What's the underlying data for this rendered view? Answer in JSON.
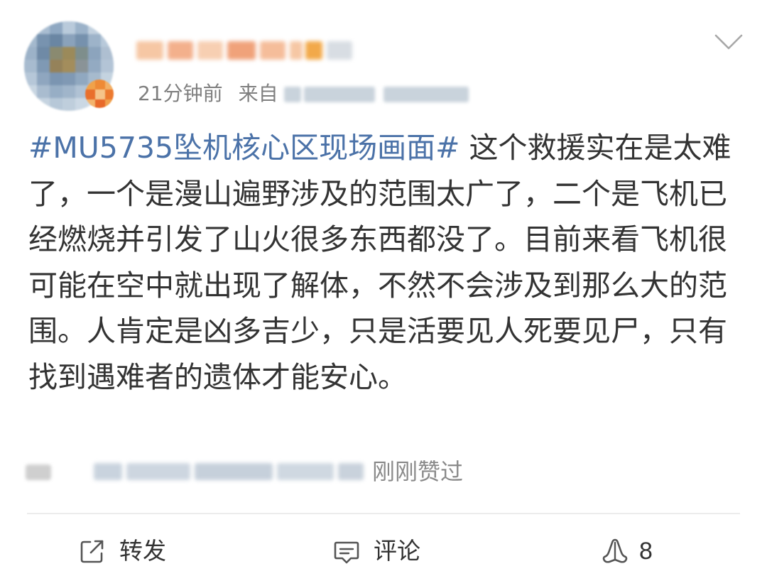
{
  "post": {
    "meta": {
      "time": "21分钟前",
      "from_prefix": "来自"
    },
    "content": {
      "hashtag": "#MU5735坠机核心区现场画面#",
      "text": " 这个救援实在是太难了，一个是漫山遍野涉及的范围太广了，二个是飞机已经燃烧并引发了山火很多东西都没了。目前来看飞机很可能在空中就出现了解体，不然不会涉及到那么大的范围。人肯定是凶多吉少，只是活要见人死要见尸，只有找到遇难者的遗体才能安心。"
    },
    "liked": {
      "suffix": "刚刚赞过"
    },
    "actions": {
      "forward": {
        "label": "转发",
        "icon": "share-out-icon"
      },
      "comment": {
        "label": "评论",
        "icon": "comment-bubble-icon"
      },
      "like": {
        "count": "8",
        "icon": "thumbs-up-icon"
      }
    },
    "menu": {
      "icon": "chevron-down-icon"
    }
  },
  "colors": {
    "hashtag": "#4b72a8",
    "body_text": "#333333",
    "meta_text": "#7f7f7f",
    "divider": "#ececec",
    "icon": "#555555"
  }
}
